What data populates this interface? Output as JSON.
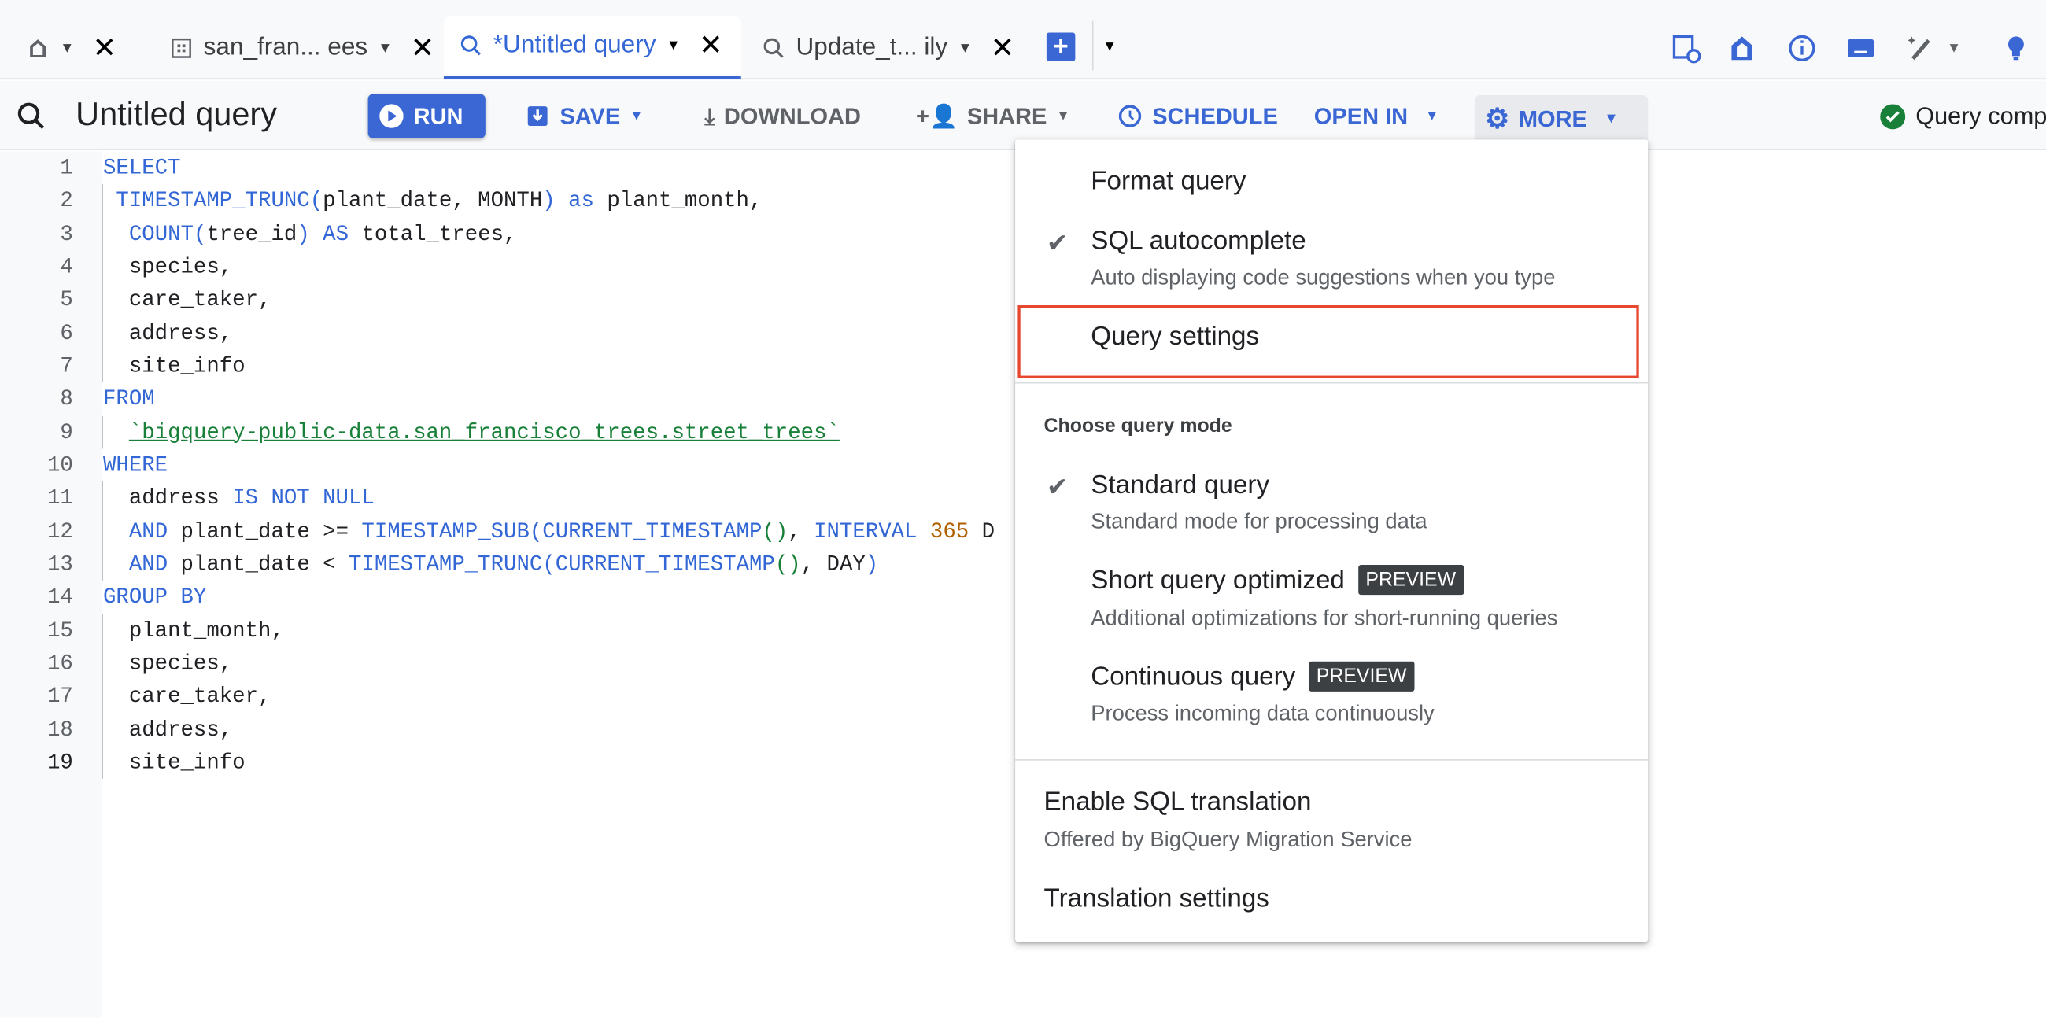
{
  "tabs": [
    {
      "label": "",
      "icon": "home-icon"
    },
    {
      "label": "san_fran... ees",
      "icon": "table-icon"
    },
    {
      "label": "*Untitled query",
      "icon": "query-icon",
      "active": true
    },
    {
      "label": "Update_t... ily",
      "icon": "query-icon"
    }
  ],
  "toolbar": {
    "title": "Untitled query",
    "run": "RUN",
    "save": "SAVE",
    "download": "DOWNLOAD",
    "share": "SHARE",
    "schedule": "SCHEDULE",
    "open_in": "OPEN IN",
    "more": "MORE",
    "status": "Query compl"
  },
  "colors": {
    "accent": "#3b67d4",
    "success": "#188038",
    "highlight": "#e8472f"
  },
  "code": [
    [
      [
        "SELECT",
        "kw"
      ]
    ],
    [
      [
        " "
      ],
      [
        "TIMESTAMP_TRUNC(",
        "kw"
      ],
      [
        "plant_date, MONTH"
      ],
      [
        ")",
        "kw"
      ],
      [
        " as ",
        "kw"
      ],
      [
        "plant_month,"
      ]
    ],
    [
      [
        "  "
      ],
      [
        "COUNT(",
        "kw"
      ],
      [
        "tree_id"
      ],
      [
        ")",
        "kw"
      ],
      [
        " AS",
        "kw"
      ],
      [
        " total_trees,"
      ]
    ],
    [
      [
        "  species,"
      ]
    ],
    [
      [
        "  care_taker,"
      ]
    ],
    [
      [
        "  address,"
      ]
    ],
    [
      [
        "  site_info"
      ]
    ],
    [
      [
        "FROM",
        "kw"
      ]
    ],
    [
      [
        "  "
      ],
      [
        "`bigquery-public-data.san_francisco_trees.street_trees`",
        "str"
      ]
    ],
    [
      [
        "WHERE",
        "kw"
      ]
    ],
    [
      [
        "  address "
      ],
      [
        "IS NOT NULL",
        "kw"
      ]
    ],
    [
      [
        "  "
      ],
      [
        "AND",
        "kw"
      ],
      [
        " plant_date >= "
      ],
      [
        "TIMESTAMP_SUB(CURRENT_TIMESTAMP",
        "kw"
      ],
      [
        "()",
        "pg"
      ],
      [
        ", "
      ],
      [
        "INTERVAL",
        "kw"
      ],
      [
        " "
      ],
      [
        "365",
        "num"
      ],
      [
        " D"
      ]
    ],
    [
      [
        "  "
      ],
      [
        "AND",
        "kw"
      ],
      [
        " plant_date < "
      ],
      [
        "TIMESTAMP_TRUNC(CURRENT_TIMESTAMP",
        "kw"
      ],
      [
        "()",
        "pg"
      ],
      [
        ", DAY"
      ],
      [
        ")",
        "kw"
      ]
    ],
    [
      [
        "GROUP BY",
        "kw"
      ]
    ],
    [
      [
        "  plant_month,"
      ]
    ],
    [
      [
        "  species,"
      ]
    ],
    [
      [
        "  care_taker,"
      ]
    ],
    [
      [
        "  address,"
      ]
    ],
    [
      [
        "  site_info"
      ]
    ]
  ],
  "menu": {
    "format_query": "Format query",
    "sql_autocomplete": "SQL autocomplete",
    "sql_autocomplete_desc": "Auto displaying code suggestions when you type",
    "sql_autocomplete_checked": true,
    "query_settings": "Query settings",
    "mode_header": "Choose query mode",
    "standard": "Standard query",
    "standard_desc": "Standard mode for processing data",
    "standard_checked": true,
    "short": "Short query optimized",
    "short_desc": "Additional optimizations for short-running queries",
    "continuous": "Continuous query",
    "continuous_desc": "Process incoming data continuously",
    "preview": "PREVIEW",
    "enable_translation": "Enable SQL translation",
    "enable_translation_desc": "Offered by BigQuery Migration Service",
    "translation_settings": "Translation settings"
  }
}
